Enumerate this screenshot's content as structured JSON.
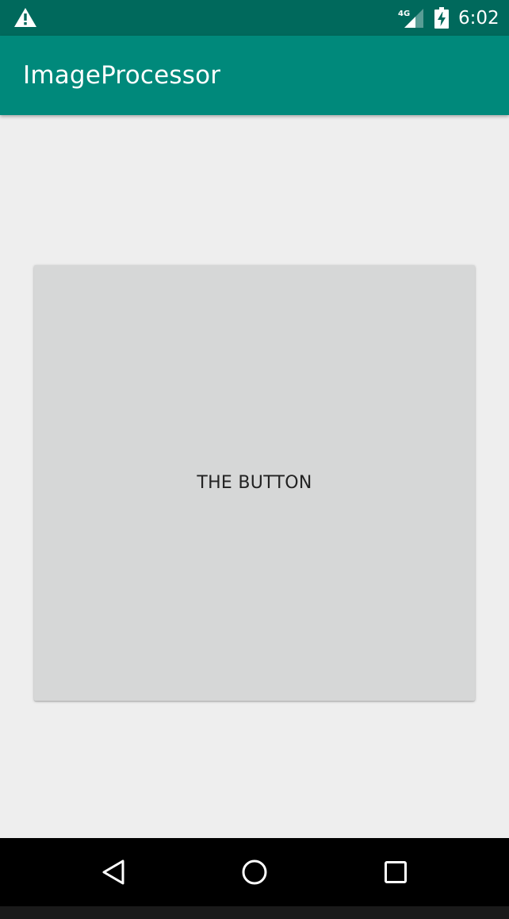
{
  "status_bar": {
    "warning_icon": "warning-icon",
    "network_label": "4G",
    "signal_icon": "cell-signal-icon",
    "battery_icon": "battery-charging-icon",
    "time": "6:02"
  },
  "app_bar": {
    "title": "ImageProcessor"
  },
  "main": {
    "button_label": "THE BUTTON"
  },
  "nav_bar": {
    "back_icon": "back-triangle-icon",
    "home_icon": "home-circle-icon",
    "recents_icon": "recents-square-icon"
  },
  "colors": {
    "status_bar": "#00695c",
    "app_bar": "#00897b",
    "background": "#eeeeee",
    "button": "#d6d7d7",
    "nav_bar": "#000000"
  }
}
